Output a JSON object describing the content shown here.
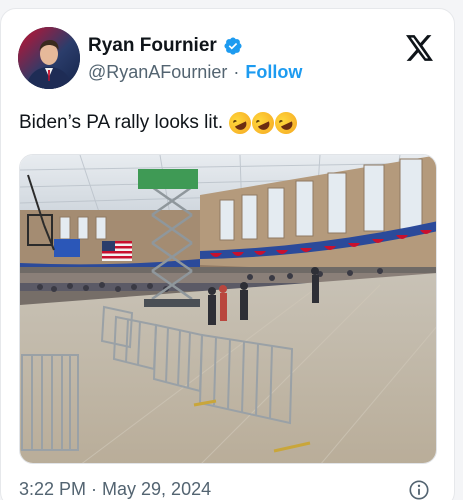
{
  "post": {
    "author": {
      "display_name": "Ryan Fournier",
      "handle": "@RyanAFournier",
      "separator": "·",
      "follow_label": "Follow"
    },
    "text": "Biden’s PA rally looks lit.",
    "emoji": [
      "rolling-on-floor-laughing",
      "rolling-on-floor-laughing",
      "rolling-on-floor-laughing"
    ],
    "timestamp": "3:22 PM · May 29, 2024"
  },
  "icons": {
    "verified": "verified-badge-icon",
    "platform": "x-logo-icon",
    "info": "info-icon"
  },
  "colors": {
    "accent": "#1d9bf0",
    "text": "#0f1419",
    "muted": "#536471"
  }
}
